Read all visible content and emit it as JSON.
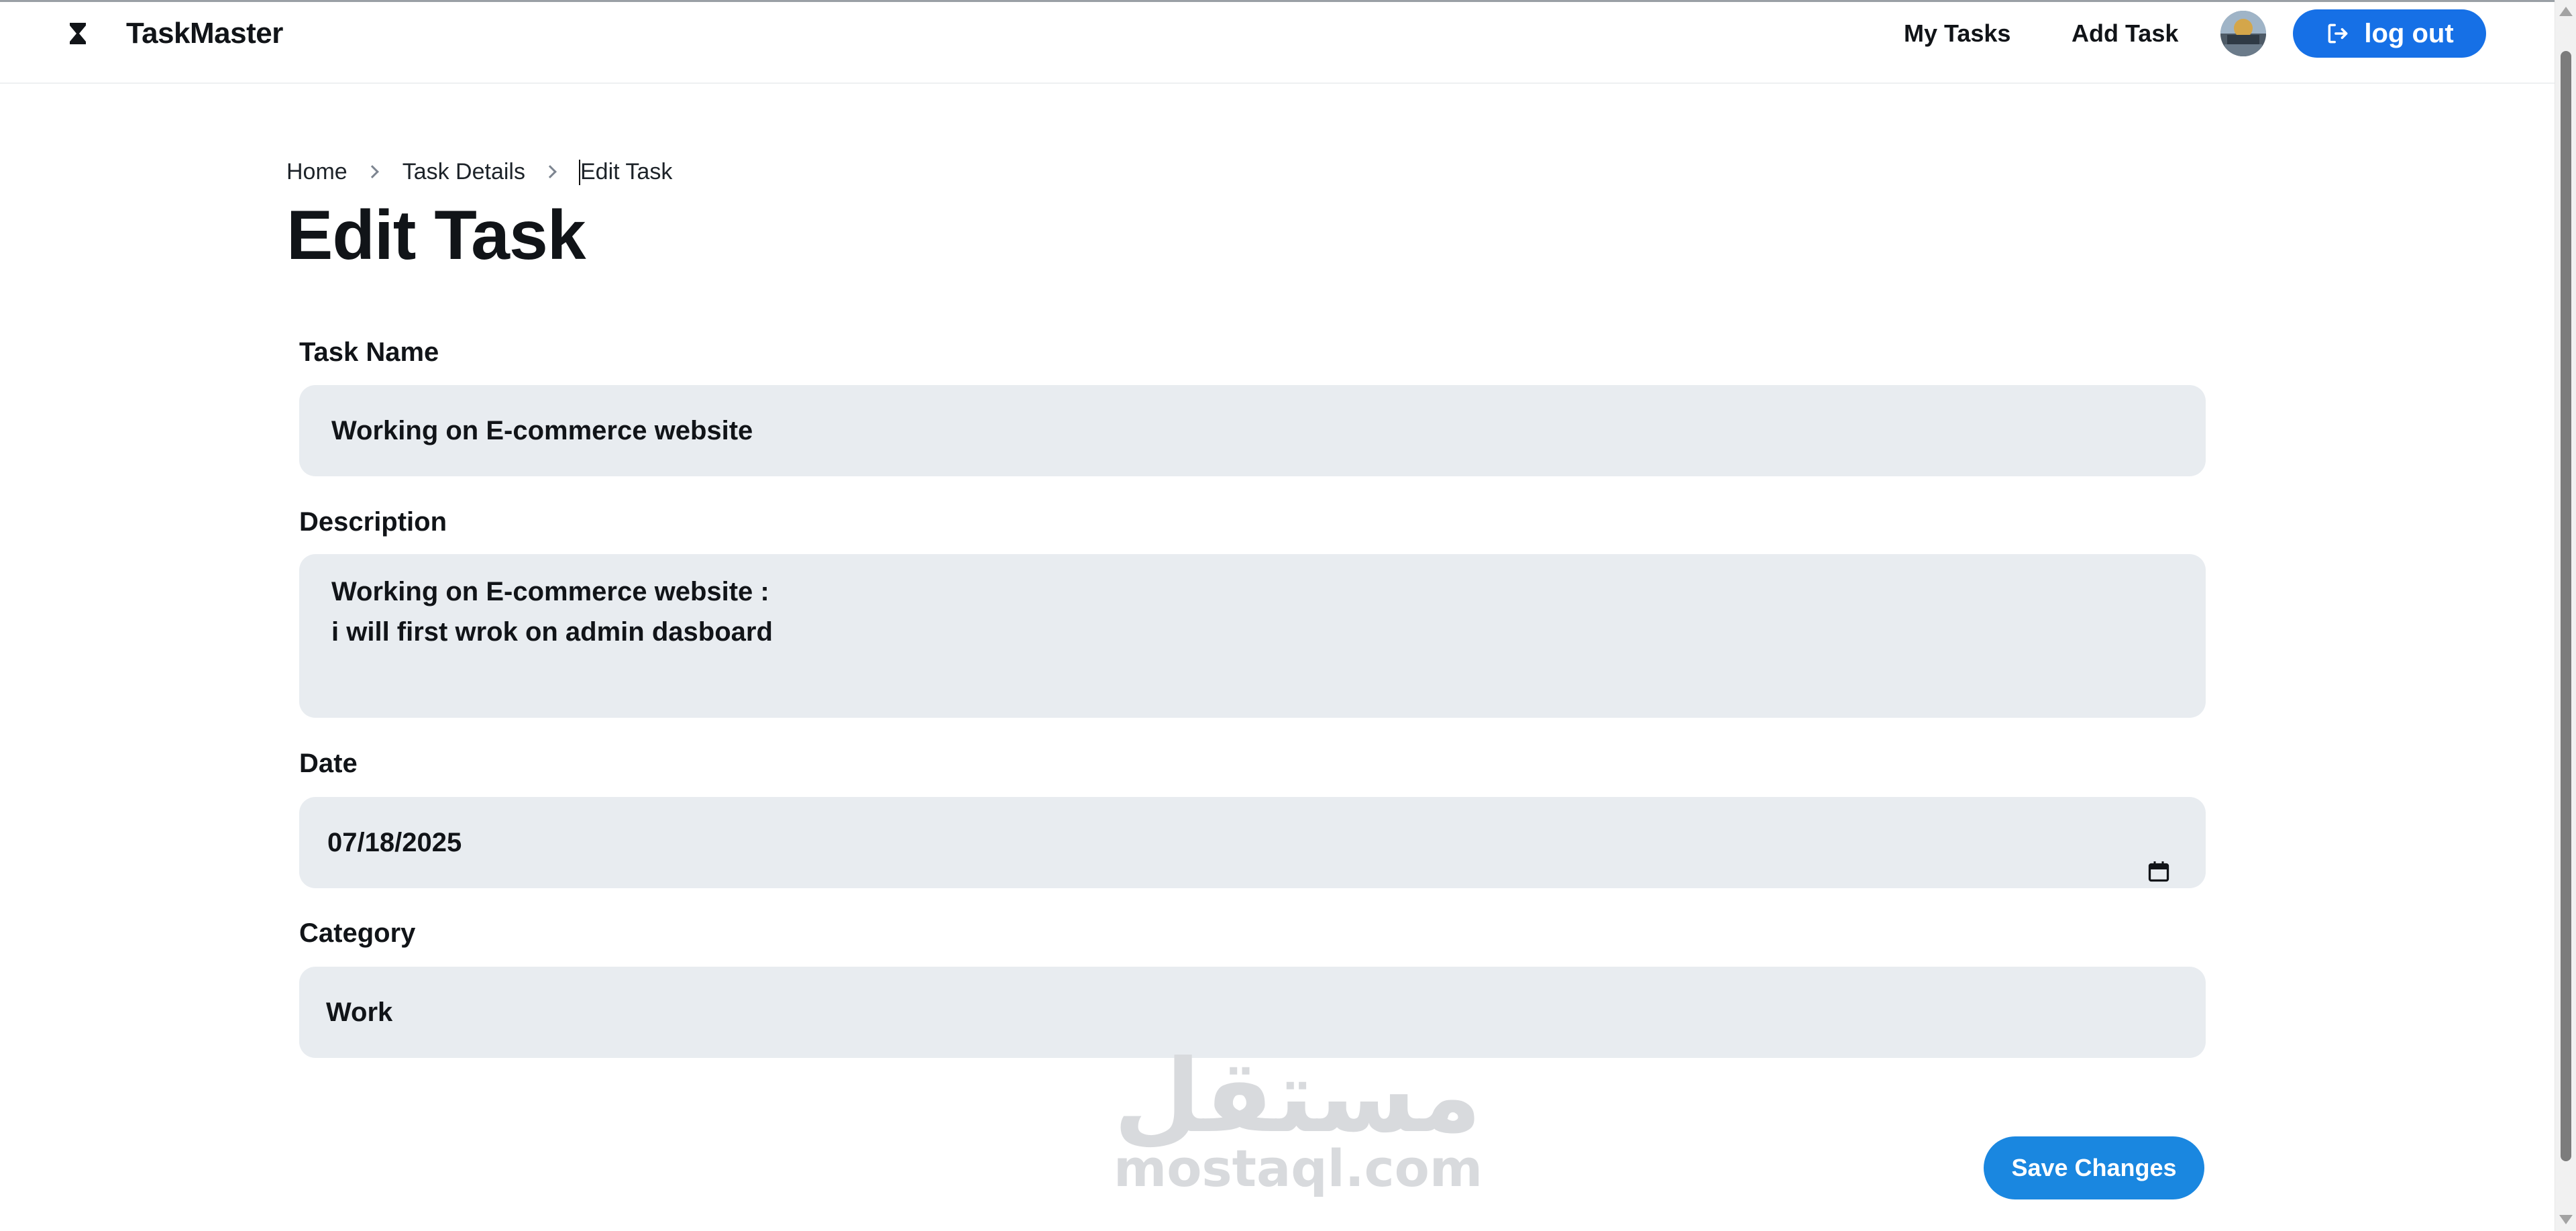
{
  "header": {
    "brand_name": "TaskMaster",
    "nav": {
      "my_tasks": "My Tasks",
      "add_task": "Add Task"
    },
    "logout_label": "log out",
    "accent_color": "#1670e6"
  },
  "breadcrumb": {
    "items": [
      "Home",
      "Task Details",
      "Edit Task"
    ]
  },
  "page": {
    "title": "Edit Task"
  },
  "form": {
    "task_name": {
      "label": "Task Name",
      "value": "Working on E-commerce website"
    },
    "description": {
      "label": "Description",
      "value": "Working on E-commerce website :\ni will first wrok on admin dasboard"
    },
    "date": {
      "label": "Date",
      "value": "07/18/2025"
    },
    "category": {
      "label": "Category",
      "value": "Work"
    },
    "save_label": "Save Changes",
    "save_color": "#1a87e0"
  },
  "watermark": {
    "arabic": "مستقل",
    "latin": "mostaql.com"
  }
}
